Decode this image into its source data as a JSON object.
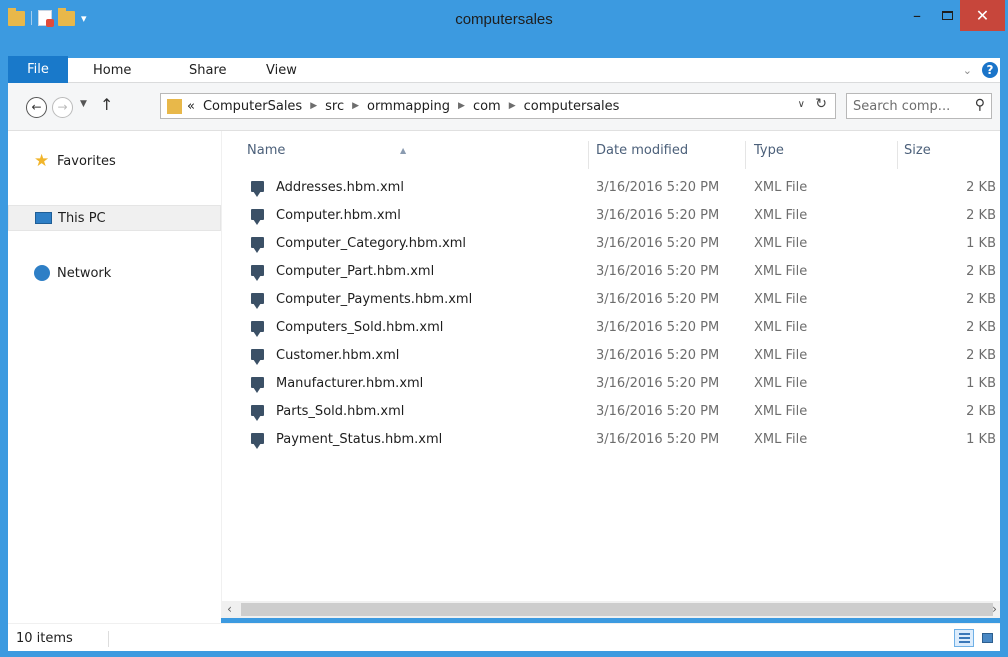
{
  "window": {
    "title": "computersales",
    "controls": {
      "minimize": "–",
      "close": "✕"
    }
  },
  "ribbon": {
    "tabs": [
      "File",
      "Home",
      "Share",
      "View"
    ],
    "collapse_icon": "chevron-down-icon",
    "help_label": "?"
  },
  "address": {
    "overflow": "«",
    "crumbs": [
      "ComputerSales",
      "src",
      "ormmapping",
      "com",
      "computersales"
    ],
    "separator": "▶"
  },
  "search": {
    "placeholder": "Search comp..."
  },
  "nav": {
    "items": [
      {
        "label": "Favorites",
        "icon": "star-icon"
      },
      {
        "label": "This PC",
        "icon": "computer-icon"
      },
      {
        "label": "Network",
        "icon": "network-icon"
      }
    ]
  },
  "columns": {
    "name": "Name",
    "date": "Date modified",
    "type": "Type",
    "size": "Size"
  },
  "files": [
    {
      "name": "Addresses.hbm.xml",
      "date": "3/16/2016 5:20 PM",
      "type": "XML File",
      "size": "2 KB"
    },
    {
      "name": "Computer.hbm.xml",
      "date": "3/16/2016 5:20 PM",
      "type": "XML File",
      "size": "2 KB"
    },
    {
      "name": "Computer_Category.hbm.xml",
      "date": "3/16/2016 5:20 PM",
      "type": "XML File",
      "size": "1 KB"
    },
    {
      "name": "Computer_Part.hbm.xml",
      "date": "3/16/2016 5:20 PM",
      "type": "XML File",
      "size": "2 KB"
    },
    {
      "name": "Computer_Payments.hbm.xml",
      "date": "3/16/2016 5:20 PM",
      "type": "XML File",
      "size": "2 KB"
    },
    {
      "name": "Computers_Sold.hbm.xml",
      "date": "3/16/2016 5:20 PM",
      "type": "XML File",
      "size": "2 KB"
    },
    {
      "name": "Customer.hbm.xml",
      "date": "3/16/2016 5:20 PM",
      "type": "XML File",
      "size": "2 KB"
    },
    {
      "name": "Manufacturer.hbm.xml",
      "date": "3/16/2016 5:20 PM",
      "type": "XML File",
      "size": "1 KB"
    },
    {
      "name": "Parts_Sold.hbm.xml",
      "date": "3/16/2016 5:20 PM",
      "type": "XML File",
      "size": "2 KB"
    },
    {
      "name": "Payment_Status.hbm.xml",
      "date": "3/16/2016 5:20 PM",
      "type": "XML File",
      "size": "1 KB"
    }
  ],
  "status": {
    "count": "10 items"
  },
  "colors": {
    "titlebar": "#3c9ae0",
    "file_tab": "#1979ca",
    "close": "#c7463b"
  }
}
